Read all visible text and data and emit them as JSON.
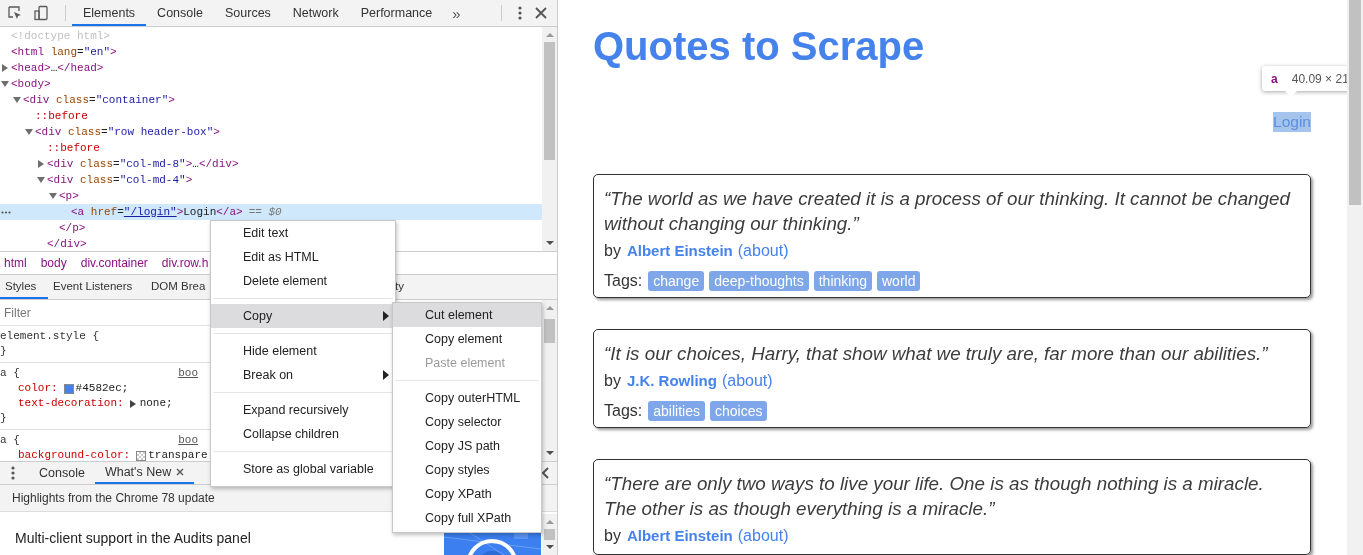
{
  "devtools": {
    "toolbar": {
      "tabs": [
        {
          "label": "Elements",
          "selected": true
        },
        {
          "label": "Console",
          "selected": false
        },
        {
          "label": "Sources",
          "selected": false
        },
        {
          "label": "Network",
          "selected": false
        },
        {
          "label": "Performance",
          "selected": false
        }
      ],
      "more": "»"
    },
    "dom_tree": [
      {
        "kind": "doctype",
        "text": "<!doctype html>"
      },
      {
        "kind": "element",
        "text": "<html lang=\"en\">",
        "children": [
          {
            "kind": "element",
            "text": "<head>…</head>",
            "expanded": false
          },
          {
            "kind": "element",
            "text": "<body>",
            "expanded": true,
            "children": [
              {
                "kind": "element",
                "text": "<div class=\"container\">",
                "expanded": true,
                "children": [
                  {
                    "kind": "pseudo",
                    "text": "::before"
                  },
                  {
                    "kind": "element",
                    "text": "<div class=\"row header-box\">",
                    "expanded": true,
                    "children": [
                      {
                        "kind": "pseudo",
                        "text": "::before"
                      },
                      {
                        "kind": "element",
                        "text": "<div class=\"col-md-8\">…</div>",
                        "expanded": false
                      },
                      {
                        "kind": "element",
                        "text": "<div class=\"col-md-4\">",
                        "expanded": true,
                        "close": "</div>",
                        "children": [
                          {
                            "kind": "element",
                            "text": "<p>",
                            "expanded": true,
                            "close": "</p>",
                            "children": [
                              {
                                "kind": "element",
                                "text": "<a href=\"/login\">Login</a>",
                                "link_values": true,
                                "suffix": "== $0",
                                "selected": true
                              }
                            ]
                          }
                        ]
                      }
                    ]
                  }
                ]
              }
            ]
          }
        ]
      }
    ],
    "breadcrumb": [
      "html",
      "body",
      "div.container",
      "div.row.h"
    ],
    "sidebar_tabs": [
      {
        "label": "Styles",
        "selected": true
      },
      {
        "label": "Event Listeners",
        "selected": false
      },
      {
        "label": "DOM Brea",
        "selected": false
      },
      {
        "label": "ty",
        "selected": false
      }
    ],
    "filter": {
      "placeholder": "Filter"
    },
    "style_rules": [
      {
        "selector": "element.style {",
        "close": "}"
      },
      {
        "selector": "a {",
        "source": "boo",
        "declarations": [
          {
            "property": "color:",
            "swatch": true,
            "value": "#4582ec;"
          },
          {
            "property": "text-decoration:",
            "expandable": true,
            "value": "none;"
          }
        ],
        "close": "}"
      },
      {
        "selector": "a {",
        "source": "boo",
        "declarations": [
          {
            "property": "background-color:",
            "swatch": true,
            "value": "transpare"
          }
        ]
      }
    ],
    "drawer_tabs": [
      {
        "label": "Console",
        "selected": false,
        "closable": false
      },
      {
        "label": "What's New",
        "selected": true,
        "closable": true
      }
    ],
    "banner": "Highlights from the Chrome 78 update",
    "article_title": "Multi-client support in the Audits panel"
  },
  "context_menu": {
    "groups": [
      [
        {
          "label": "Edit text",
          "selected": false
        },
        {
          "label": "Edit as HTML",
          "selected": false
        },
        {
          "label": "Delete element",
          "selected": false
        }
      ],
      [
        {
          "label": "Copy",
          "selected": true,
          "submenu": true
        }
      ],
      [
        {
          "label": "Hide element",
          "selected": false
        },
        {
          "label": "Break on",
          "selected": false,
          "submenu": true
        }
      ],
      [
        {
          "label": "Expand recursively",
          "selected": false
        },
        {
          "label": "Collapse children",
          "selected": false
        }
      ],
      [
        {
          "label": "Store as global variable",
          "selected": false
        }
      ]
    ]
  },
  "copy_submenu": {
    "groups": [
      [
        {
          "label": "Cut element",
          "selected": true,
          "disabled": false
        },
        {
          "label": "Copy element",
          "selected": false,
          "disabled": false
        },
        {
          "label": "Paste element",
          "selected": false,
          "disabled": true
        }
      ],
      [
        {
          "label": "Copy outerHTML",
          "selected": false,
          "disabled": false
        },
        {
          "label": "Copy selector",
          "selected": false,
          "disabled": false
        },
        {
          "label": "Copy JS path",
          "selected": false,
          "disabled": false
        },
        {
          "label": "Copy styles",
          "selected": false,
          "disabled": false
        },
        {
          "label": "Copy XPath",
          "selected": false,
          "disabled": false
        },
        {
          "label": "Copy full XPath",
          "selected": false,
          "disabled": false
        }
      ]
    ]
  },
  "page": {
    "title": "Quotes to Scrape",
    "login": {
      "label": "Login",
      "highlighted": true
    },
    "inspect_tooltip": {
      "tag": "a",
      "size": "40.09 × 21"
    },
    "quotes": [
      {
        "text": "“The world as we have created it is a process of our thinking. It cannot be changed without changing our thinking.”",
        "by": "by",
        "author": "Albert Einstein",
        "about": "(about)",
        "tags_label": "Tags:",
        "tags": [
          "change",
          "deep-thoughts",
          "thinking",
          "world"
        ]
      },
      {
        "text": "“It is our choices, Harry, that show what we truly are, far more than our abilities.”",
        "by": "by",
        "author": "J.K. Rowling",
        "about": "(about)",
        "tags_label": "Tags:",
        "tags": [
          "abilities",
          "choices"
        ]
      },
      {
        "text": "“There are only two ways to live your life. One is as though nothing is a miracle. The other is as though everything is a miracle.”",
        "by": "by",
        "author": "Albert Einstein",
        "about": "(about)"
      }
    ]
  }
}
